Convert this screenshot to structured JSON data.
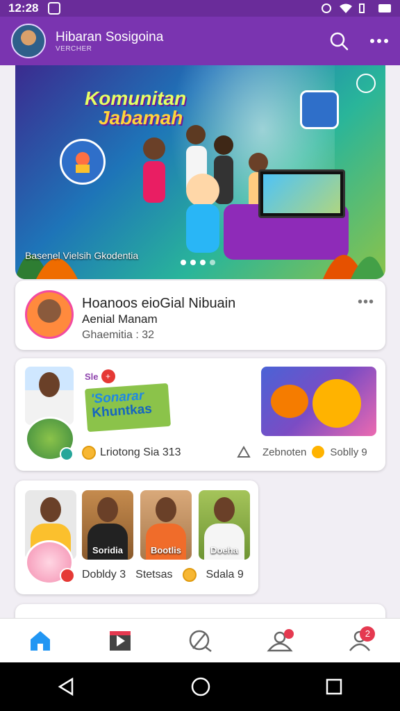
{
  "status_bar": {
    "time": "12:28"
  },
  "app_bar": {
    "title": "Hibaran Sosigoina",
    "subtitle": "VERCHER",
    "search_icon": "search-icon",
    "more_icon": "more-horizontal-icon"
  },
  "banner": {
    "headline_1": "Komunitan",
    "headline_2": "Jabamah",
    "caption": "Basenel Vielsih Gkodentia",
    "dots": [
      true,
      false,
      false,
      false
    ],
    "share_icon": "share-icon"
  },
  "profile_card": {
    "name": "Hoanoos eioGial Nibuain",
    "subtitle": "Aenial Manam",
    "meta": "Ghaemitia : 32"
  },
  "card2": {
    "tag_text": "Sle",
    "tag_badge": "+",
    "sticker_line1": "'Sonarar",
    "sticker_line2": "Khuntkas",
    "footer_left": "Lriotong Sia 313",
    "footer_right_1": "Zebnoten",
    "footer_right_2": "Soblly 9"
  },
  "card3": {
    "thumbs": [
      {
        "label": ""
      },
      {
        "label": "Soridia"
      },
      {
        "label": "Bootlis"
      },
      {
        "label": "Doeha"
      }
    ],
    "foot_1": "Dobldy 3",
    "foot_2": "Stetsas",
    "foot_3": "Sdala 9"
  },
  "bottom_nav": {
    "items": [
      {
        "icon": "home-icon",
        "active": true
      },
      {
        "icon": "video-icon"
      },
      {
        "icon": "chat-icon"
      },
      {
        "icon": "community-icon"
      },
      {
        "icon": "profile-icon",
        "badge": "2"
      }
    ]
  },
  "colors": {
    "app_bar": "#7a34b0",
    "status_bar": "#6a2c9a",
    "nav_active": "#2196f3",
    "badge": "#e53950"
  }
}
